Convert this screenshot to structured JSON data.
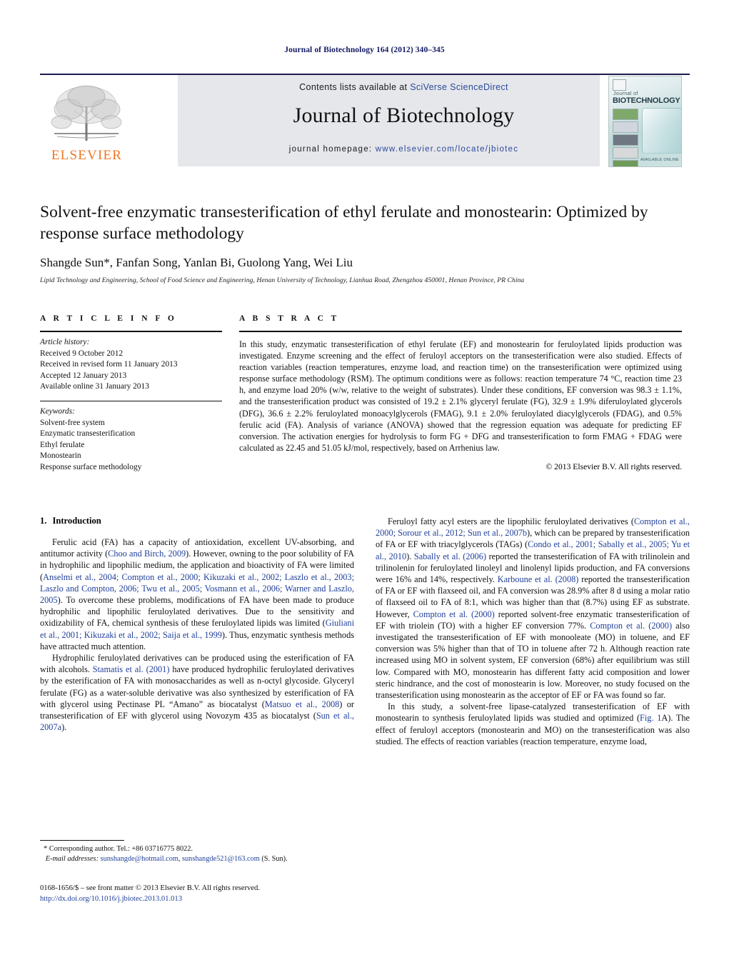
{
  "running_head": "Journal of Biotechnology 164 (2012) 340–345",
  "masthead": {
    "contents_prefix": "Contents lists available at ",
    "contents_link": "SciVerse ScienceDirect",
    "journal_name": "Journal of Biotechnology",
    "homepage_label": "journal homepage: ",
    "homepage_url": "www.elsevier.com/locate/jbiotec",
    "publisher_wordmark": "ELSEVIER",
    "cover_small_label": "Journal of",
    "cover_title": "BIOTECHNOLOGY",
    "cover_footer": "AVAILABLE ONLINE",
    "link_color": "#2b4a9b",
    "elsevier_orange": "#ef7622"
  },
  "title": "Solvent-free enzymatic transesterification of ethyl ferulate and monostearin: Optimized by response surface methodology",
  "authors": "Shangde Sun*, Fanfan Song, Yanlan Bi, Guolong Yang, Wei Liu",
  "affiliation": "Lipid Technology and Engineering, School of Food Science and Engineering, Henan University of Technology, Lianhua Road, Zhengzhou 450001, Henan Province, PR China",
  "article_info": {
    "heading": "A R T I C L E    I N F O",
    "history_label": "Article history:",
    "history": [
      "Received 9 October 2012",
      "Received in revised form 11 January 2013",
      "Accepted 12 January 2013",
      "Available online 31 January 2013"
    ],
    "keywords_label": "Keywords:",
    "keywords": [
      "Solvent-free system",
      "Enzymatic transesterification",
      "Ethyl ferulate",
      "Monostearin",
      "Response surface methodology"
    ]
  },
  "abstract": {
    "heading": "A B S T R A C T",
    "text": "In this study, enzymatic transesterification of ethyl ferulate (EF) and monostearin for feruloylated lipids production was investigated. Enzyme screening and the effect of feruloyl acceptors on the transesterification were also studied. Effects of reaction variables (reaction temperatures, enzyme load, and reaction time) on the transesterification were optimized using response surface methodology (RSM). The optimum conditions were as follows: reaction temperature 74 °C, reaction time 23 h, and enzyme load 20% (w/w, relative to the weight of substrates). Under these conditions, EF conversion was 98.3 ± 1.1%, and the transesterification product was consisted of 19.2 ± 2.1% glyceryl ferulate (FG), 32.9 ± 1.9% diferuloylated glycerols (DFG), 36.6 ± 2.2% feruloylated monoacylglycerols (FMAG), 9.1 ± 2.0% feruloylated diacylglycerols (FDAG), and 0.5% ferulic acid (FA). Analysis of variance (ANOVA) showed that the regression equation was adequate for predicting EF conversion. The activation energies for hydrolysis to form FG + DFG and transesterification to form FMAG + FDAG were calculated as 22.45 and 51.05 kJ/mol, respectively, based on Arrhenius law.",
    "copyright": "© 2013 Elsevier B.V. All rights reserved."
  },
  "section": {
    "number": "1.",
    "name": "Introduction"
  },
  "left_column": {
    "p1_a": "Ferulic acid (FA) has a capacity of antioxidation, excellent UV-absorbing, and antitumor activity (",
    "p1_cit1": "Choo and Birch, 2009",
    "p1_b": "). However, owning to the poor solubility of FA in hydrophilic and lipophilic medium, the application and bioactivity of FA were limited (",
    "p1_cit2": "Anselmi et al., 2004; Compton et al., 2000; Kikuzaki et al., 2002; Laszlo et al., 2003; Laszlo and Compton, 2006; Twu et al., 2005; Vosmann et al., 2006; Warner and Laszlo, 2005",
    "p1_c": "). To overcome these problems, modifications of FA have been made to produce hydrophilic and lipophilic feruloylated derivatives. Due to the sensitivity and oxidizability of FA, chemical synthesis of these feruloylated lipids was limited (",
    "p1_cit3": "Giuliani et al., 2001; Kikuzaki et al., 2002; Saija et al., 1999",
    "p1_d": "). Thus, enzymatic synthesis methods have attracted much attention.",
    "p2_a": "Hydrophilic feruloylated derivatives can be produced using the esterification of FA with alcohols. ",
    "p2_cit1": "Stamatis et al. (2001)",
    "p2_b": " have produced hydrophilic feruloylated derivatives by the esterification of FA with monosaccharides as well as n-octyl glycoside. Glyceryl ferulate (FG) as a water-soluble derivative was also synthesized by esterification of FA with glycerol using Pectinase PL “Amano” as biocatalyst (",
    "p2_cit2": "Matsuo et al., 2008",
    "p2_c": ") or transesterification of EF with glycerol using Novozym 435 as biocatalyst (",
    "p2_cit3": "Sun et al., 2007a",
    "p2_d": ")."
  },
  "right_column": {
    "p1_a": "Feruloyl fatty acyl esters are the lipophilic feruloylated derivatives (",
    "p1_cit1": "Compton et al., 2000; Sorour et al., 2012; Sun et al., 2007b",
    "p1_b": "), which can be prepared by transesterification of FA or EF with triacylglycerols (TAGs) (",
    "p1_cit2": "Condo et al., 2001; Sabally et al., 2005; Yu et al., 2010",
    "p1_c": "). ",
    "p1_cit3": "Sabally et al. (2006)",
    "p1_d": " reported the transesterification of FA with trilinolein and trilinolenin for feruloylated linoleyl and linolenyl lipids production, and FA conversions were 16% and 14%, respectively. ",
    "p1_cit4": "Karboune et al. (2008)",
    "p1_e": " reported the transesterification of FA or EF with flaxseed oil, and FA conversion was 28.9% after 8 d using a molar ratio of flaxseed oil to FA of 8:1, which was higher than that (8.7%) using EF as substrate. However, ",
    "p1_cit5": "Compton et al. (2000)",
    "p1_f": " reported solvent-free enzymatic transesterification of EF with triolein (TO) with a higher EF conversion 77%. ",
    "p1_cit6": "Compton et al. (2000)",
    "p1_g": " also investigated the transesterification of EF with monooleate (MO) in toluene, and EF conversion was 5% higher than that of TO in toluene after 72 h. Although reaction rate increased using MO in solvent system, EF conversion (68%) after equilibrium was still low. Compared with MO, monostearin has different fatty acid composition and lower steric hindrance, and the cost of monostearin is low. Moreover, no study focused on the transesterification using monostearin as the acceptor of EF or FA was found so far.",
    "p2_a": "In this study, a solvent-free lipase-catalyzed transesterification of EF with monostearin to synthesis feruloylated lipids was studied and optimized (",
    "p2_cit1": "Fig. 1",
    "p2_b": "A). The effect of feruloyl acceptors (monostearin and MO) on the transesterification was also studied. The effects of reaction variables (reaction temperature, enzyme load,"
  },
  "footnote": {
    "marker": "*",
    "corresponding": "Corresponding author. Tel.: +86 03716775 8022.",
    "email_label": "E-mail addresses:",
    "email1": "sunshangde@hotmail.com",
    "email_sep": ", ",
    "email2": "sunshangde521@163.com",
    "email_suffix": " (S. Sun)."
  },
  "frontmatter": {
    "line1": "0168-1656/$ – see front matter © 2013 Elsevier B.V. All rights reserved.",
    "doi": "http://dx.doi.org/10.1016/j.jbiotec.2013.01.013"
  }
}
